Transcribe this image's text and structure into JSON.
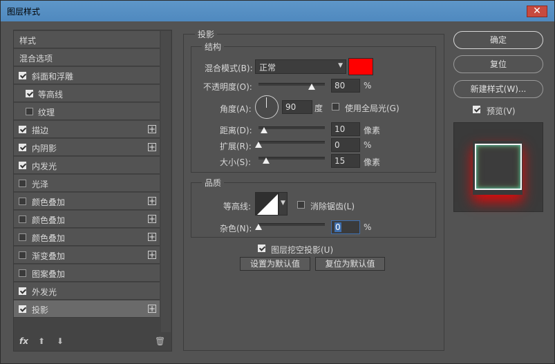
{
  "window": {
    "title": "图层样式",
    "close": "✕"
  },
  "left_list": {
    "items": [
      {
        "label": "样式",
        "checkbox": null,
        "plus": false
      },
      {
        "label": "混合选项",
        "checkbox": null,
        "plus": false
      },
      {
        "label": "斜面和浮雕",
        "checkbox": true,
        "plus": false
      },
      {
        "label": "等高线",
        "checkbox": true,
        "plus": false,
        "indent": true
      },
      {
        "label": "纹理",
        "checkbox": false,
        "plus": false,
        "indent": true
      },
      {
        "label": "描边",
        "checkbox": true,
        "plus": true
      },
      {
        "label": "内阴影",
        "checkbox": true,
        "plus": true
      },
      {
        "label": "内发光",
        "checkbox": true,
        "plus": false
      },
      {
        "label": "光泽",
        "checkbox": false,
        "plus": false
      },
      {
        "label": "颜色叠加",
        "checkbox": false,
        "plus": true
      },
      {
        "label": "颜色叠加",
        "checkbox": false,
        "plus": true
      },
      {
        "label": "颜色叠加",
        "checkbox": false,
        "plus": true
      },
      {
        "label": "渐变叠加",
        "checkbox": false,
        "plus": true
      },
      {
        "label": "图案叠加",
        "checkbox": false,
        "plus": false
      },
      {
        "label": "外发光",
        "checkbox": true,
        "plus": false
      },
      {
        "label": "投影",
        "checkbox": true,
        "plus": true,
        "selected": true
      }
    ],
    "bottom": {
      "fx": "fx",
      "up": "⬆",
      "down": "⬇",
      "trash": "🗑"
    }
  },
  "drop_shadow": {
    "title": "投影",
    "structure": {
      "title": "结构",
      "blend_mode_label": "混合模式(B):",
      "blend_mode_value": "正常",
      "color": "#ff0000",
      "opacity_label": "不透明度(O):",
      "opacity_value": "80",
      "opacity_unit": "%",
      "opacity_fraction": 0.8,
      "angle_label": "角度(A):",
      "angle_value": "90",
      "angle_unit": "度",
      "global_light_label": "使用全局光(G)",
      "global_light": false,
      "distance_label": "距离(D):",
      "distance_value": "10",
      "distance_unit": "像素",
      "spread_label": "扩展(R):",
      "spread_value": "0",
      "spread_unit": "%",
      "size_label": "大小(S):",
      "size_value": "15",
      "size_unit": "像素"
    },
    "quality": {
      "title": "品质",
      "contour_label": "等高线:",
      "anti_alias_label": "消除锯齿(L)",
      "anti_alias": false,
      "noise_label": "杂色(N):",
      "noise_value": "0",
      "noise_unit": "%"
    },
    "knockout_label": "图层挖空投影(U)",
    "knockout": true,
    "set_default": "设置为默认值",
    "reset_default": "复位为默认值"
  },
  "right": {
    "ok": "确定",
    "reset": "复位",
    "new_style": "新建样式(W)...",
    "preview_label": "预览(V)",
    "preview": true
  }
}
